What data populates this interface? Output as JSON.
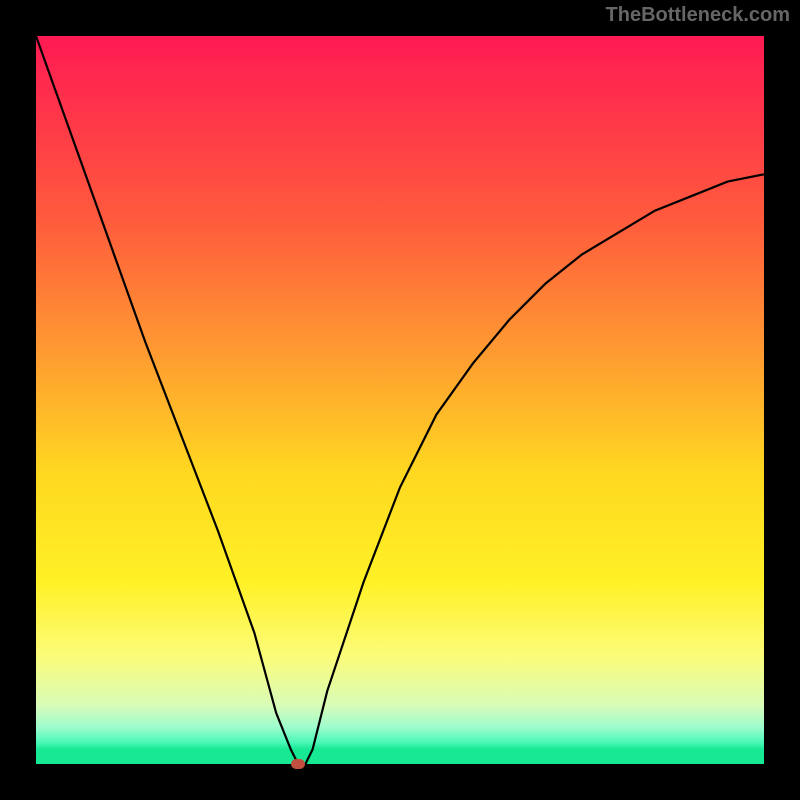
{
  "watermark": "TheBottleneck.com",
  "chart_data": {
    "type": "line",
    "title": "",
    "xlabel": "",
    "ylabel": "",
    "xlim": [
      0,
      100
    ],
    "ylim": [
      0,
      100
    ],
    "background_gradient": {
      "top": "#ff1a53",
      "middle": "#ffd820",
      "bottom": "#17e893"
    },
    "series": [
      {
        "name": "bottleneck-curve",
        "x": [
          0,
          5,
          10,
          15,
          20,
          25,
          30,
          33,
          35,
          36,
          37,
          38,
          40,
          45,
          50,
          55,
          60,
          65,
          70,
          75,
          80,
          85,
          90,
          95,
          100
        ],
        "y": [
          100,
          86,
          72,
          58,
          45,
          32,
          18,
          7,
          2,
          0,
          0,
          2,
          10,
          25,
          38,
          48,
          55,
          61,
          66,
          70,
          73,
          76,
          78,
          80,
          81
        ]
      }
    ],
    "annotations": [
      {
        "name": "min-marker",
        "x": 36,
        "y": 0,
        "color": "#c1503e"
      }
    ]
  }
}
